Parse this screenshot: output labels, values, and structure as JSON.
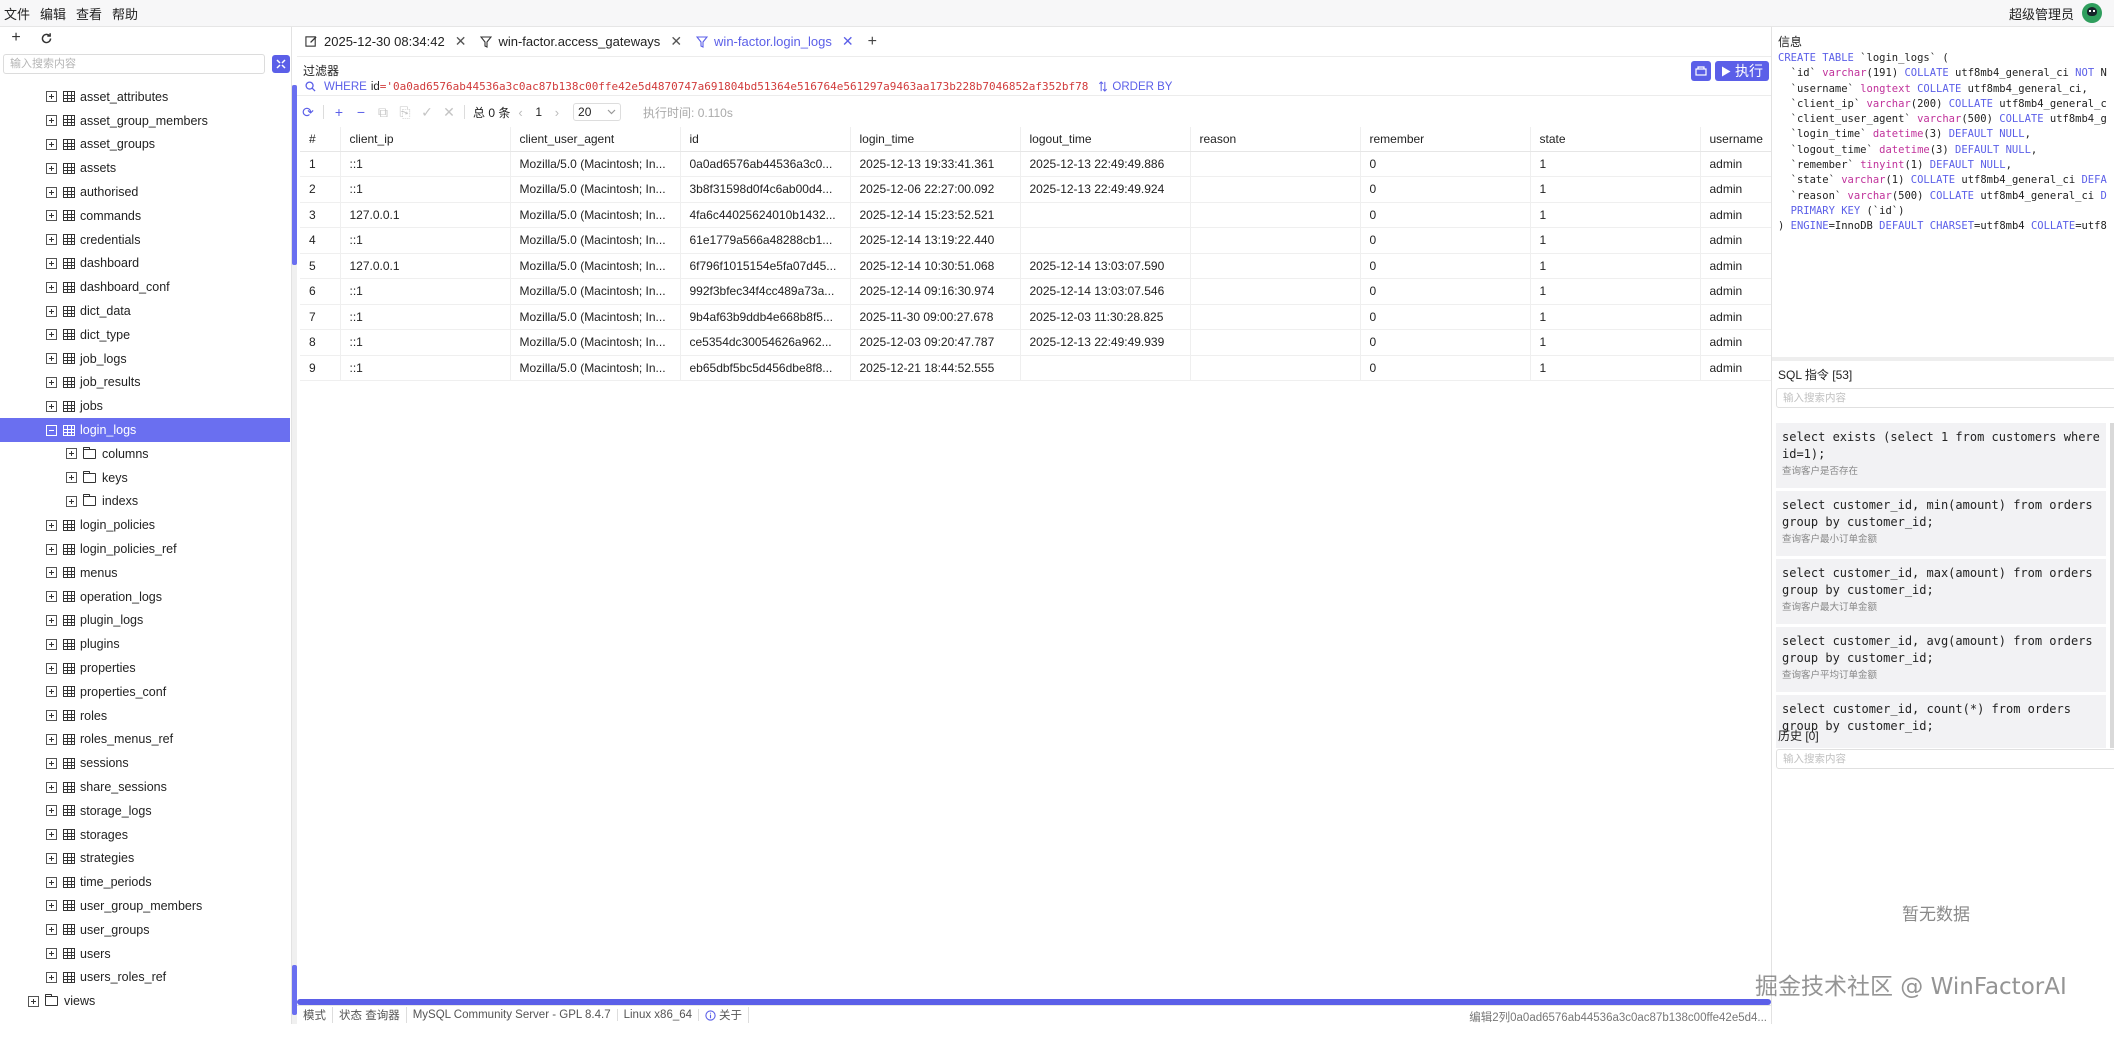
{
  "menubar": {
    "items": [
      "文件",
      "编辑",
      "查看",
      "帮助"
    ],
    "user": "超级管理员"
  },
  "sidebar": {
    "search_placeholder": "输入搜索内容",
    "tree": [
      {
        "label": "asset_attributes",
        "type": "table",
        "level": 1,
        "expanded": false
      },
      {
        "label": "asset_group_members",
        "type": "table",
        "level": 1,
        "expanded": false
      },
      {
        "label": "asset_groups",
        "type": "table",
        "level": 1,
        "expanded": false
      },
      {
        "label": "assets",
        "type": "table",
        "level": 1,
        "expanded": false
      },
      {
        "label": "authorised",
        "type": "table",
        "level": 1,
        "expanded": false
      },
      {
        "label": "commands",
        "type": "table",
        "level": 1,
        "expanded": false
      },
      {
        "label": "credentials",
        "type": "table",
        "level": 1,
        "expanded": false
      },
      {
        "label": "dashboard",
        "type": "table",
        "level": 1,
        "expanded": false
      },
      {
        "label": "dashboard_conf",
        "type": "table",
        "level": 1,
        "expanded": false
      },
      {
        "label": "dict_data",
        "type": "table",
        "level": 1,
        "expanded": false
      },
      {
        "label": "dict_type",
        "type": "table",
        "level": 1,
        "expanded": false
      },
      {
        "label": "job_logs",
        "type": "table",
        "level": 1,
        "expanded": false
      },
      {
        "label": "job_results",
        "type": "table",
        "level": 1,
        "expanded": false
      },
      {
        "label": "jobs",
        "type": "table",
        "level": 1,
        "expanded": false
      },
      {
        "label": "login_logs",
        "type": "table",
        "level": 1,
        "expanded": true,
        "selected": true
      },
      {
        "label": "columns",
        "type": "folder",
        "level": 2,
        "expanded": false
      },
      {
        "label": "keys",
        "type": "folder",
        "level": 2,
        "expanded": false
      },
      {
        "label": "indexs",
        "type": "folder",
        "level": 2,
        "expanded": false
      },
      {
        "label": "login_policies",
        "type": "table",
        "level": 1,
        "expanded": false
      },
      {
        "label": "login_policies_ref",
        "type": "table",
        "level": 1,
        "expanded": false
      },
      {
        "label": "menus",
        "type": "table",
        "level": 1,
        "expanded": false
      },
      {
        "label": "operation_logs",
        "type": "table",
        "level": 1,
        "expanded": false
      },
      {
        "label": "plugin_logs",
        "type": "table",
        "level": 1,
        "expanded": false
      },
      {
        "label": "plugins",
        "type": "table",
        "level": 1,
        "expanded": false
      },
      {
        "label": "properties",
        "type": "table",
        "level": 1,
        "expanded": false
      },
      {
        "label": "properties_conf",
        "type": "table",
        "level": 1,
        "expanded": false
      },
      {
        "label": "roles",
        "type": "table",
        "level": 1,
        "expanded": false
      },
      {
        "label": "roles_menus_ref",
        "type": "table",
        "level": 1,
        "expanded": false
      },
      {
        "label": "sessions",
        "type": "table",
        "level": 1,
        "expanded": false
      },
      {
        "label": "share_sessions",
        "type": "table",
        "level": 1,
        "expanded": false
      },
      {
        "label": "storage_logs",
        "type": "table",
        "level": 1,
        "expanded": false
      },
      {
        "label": "storages",
        "type": "table",
        "level": 1,
        "expanded": false
      },
      {
        "label": "strategies",
        "type": "table",
        "level": 1,
        "expanded": false
      },
      {
        "label": "time_periods",
        "type": "table",
        "level": 1,
        "expanded": false
      },
      {
        "label": "user_group_members",
        "type": "table",
        "level": 1,
        "expanded": false
      },
      {
        "label": "user_groups",
        "type": "table",
        "level": 1,
        "expanded": false
      },
      {
        "label": "users",
        "type": "table",
        "level": 1,
        "expanded": false
      },
      {
        "label": "users_roles_ref",
        "type": "table",
        "level": 1,
        "expanded": false
      },
      {
        "label": "views",
        "type": "folder",
        "level": 0,
        "expanded": false
      }
    ]
  },
  "tabs": [
    {
      "label": "2025-12-30 08:34:42",
      "icon": "edit-icon",
      "active": false
    },
    {
      "label": "win-factor.access_gateways",
      "icon": "filter-icon",
      "active": false
    },
    {
      "label": "win-factor.login_logs",
      "icon": "filter-icon",
      "active": true
    }
  ],
  "filter": {
    "label": "过滤器",
    "run_label": "执行",
    "where_keyword": "WHERE",
    "where_field": "id",
    "where_value": "='0a0ad6576ab44536a3c0ac87b138c00ffe42e5d4870747a691804bd51364e516764e561297a9463aa173b228b7046852af352bf78",
    "order_keyword": "ORDER BY"
  },
  "grid_toolbar": {
    "total": "总 0 条",
    "page": "1",
    "page_size": "20",
    "exec_time": "执行时间: 0.110s"
  },
  "table": {
    "columns": [
      "#",
      "client_ip",
      "client_user_agent",
      "id",
      "login_time",
      "logout_time",
      "reason",
      "remember",
      "state",
      "username"
    ],
    "rows": [
      [
        "1",
        "::1",
        "Mozilla/5.0 (Macintosh; In...",
        "0a0ad6576ab44536a3c0...",
        "2025-12-13 19:33:41.361",
        "2025-12-13 22:49:49.886",
        "",
        "0",
        "1",
        "admin"
      ],
      [
        "2",
        "::1",
        "Mozilla/5.0 (Macintosh; In...",
        "3b8f31598d0f4c6ab00d4...",
        "2025-12-06 22:27:00.092",
        "2025-12-13 22:49:49.924",
        "",
        "0",
        "1",
        "admin"
      ],
      [
        "3",
        "127.0.0.1",
        "Mozilla/5.0 (Macintosh; In...",
        "4fa6c44025624010b1432...",
        "2025-12-14 15:23:52.521",
        "",
        "",
        "0",
        "1",
        "admin"
      ],
      [
        "4",
        "::1",
        "Mozilla/5.0 (Macintosh; In...",
        "61e1779a566a48288cb1...",
        "2025-12-14 13:19:22.440",
        "",
        "",
        "0",
        "1",
        "admin"
      ],
      [
        "5",
        "127.0.0.1",
        "Mozilla/5.0 (Macintosh; In...",
        "6f796f1015154e5fa07d45...",
        "2025-12-14 10:30:51.068",
        "2025-12-14 13:03:07.590",
        "",
        "0",
        "1",
        "admin"
      ],
      [
        "6",
        "::1",
        "Mozilla/5.0 (Macintosh; In...",
        "992f3bfec34f4cc489a73a...",
        "2025-12-14 09:16:30.974",
        "2025-12-14 13:03:07.546",
        "",
        "0",
        "1",
        "admin"
      ],
      [
        "7",
        "::1",
        "Mozilla/5.0 (Macintosh; In...",
        "9b4af63b9ddb4e668b8f5...",
        "2025-11-30 09:00:27.678",
        "2025-12-03 11:30:28.825",
        "",
        "0",
        "1",
        "admin"
      ],
      [
        "8",
        "::1",
        "Mozilla/5.0 (Macintosh; In...",
        "ce5354dc30054626a962...",
        "2025-12-03 09:20:47.787",
        "2025-12-13 22:49:49.939",
        "",
        "0",
        "1",
        "admin"
      ],
      [
        "9",
        "::1",
        "Mozilla/5.0 (Macintosh; In...",
        "eb65dbf5bc5d456dbe8f8...",
        "2025-12-21 18:44:52.555",
        "",
        "",
        "0",
        "1",
        "admin"
      ]
    ]
  },
  "statusbar": {
    "items": [
      "模式",
      "状态 查询器",
      "MySQL Community Server - GPL 8.4.7",
      "Linux x86_64",
      "关于"
    ],
    "right": "编辑2列0a0ad6576ab44536a3c0ac87b138c00ffe42e5d4..."
  },
  "right_panel": {
    "info_title": "信息",
    "ddl_lines": [
      "CREATE TABLE `login_logs` (",
      "  `id` varchar(191) COLLATE utf8mb4_general_ci NOT N",
      "  `username` longtext COLLATE utf8mb4_general_ci,",
      "  `client_ip` varchar(200) COLLATE utf8mb4_general_c",
      "  `client_user_agent` varchar(500) COLLATE utf8mb4_g",
      "  `login_time` datetime(3) DEFAULT NULL,",
      "  `logout_time` datetime(3) DEFAULT NULL,",
      "  `remember` tinyint(1) DEFAULT NULL,",
      "  `state` varchar(1) COLLATE utf8mb4_general_ci DEFA",
      "  `reason` varchar(500) COLLATE utf8mb4_general_ci D",
      "  PRIMARY KEY (`id`)",
      ") ENGINE=InnoDB DEFAULT CHARSET=utf8mb4 COLLATE=utf8"
    ],
    "sql_title": "SQL 指令 [53]",
    "sql_search_placeholder": "输入搜索内容",
    "sql_items": [
      {
        "sql": "select exists (select 1 from customers where id=1);",
        "desc": "查询客户是否存在"
      },
      {
        "sql": "select customer_id, min(amount) from orders group by customer_id;",
        "desc": "查询客户最小订单金额"
      },
      {
        "sql": "select customer_id, max(amount) from orders group by customer_id;",
        "desc": "查询客户最大订单金额"
      },
      {
        "sql": "select customer_id, avg(amount) from orders group by customer_id;",
        "desc": "查询客户平均订单金额"
      },
      {
        "sql": "select customer_id, count(*) from orders group by customer_id;",
        "desc": ""
      }
    ],
    "history_title": "历史 [0]",
    "history_search_placeholder": "输入搜索内容",
    "history_empty": "暂无数据"
  },
  "watermark": "掘金技术社区 @ WinFactorAI",
  "colors": {
    "accent": "#5b5fe8",
    "selected_row": "#6a6ff0",
    "ddl_keyword": "#5b5fe8",
    "ddl_type": "#c0329b"
  }
}
